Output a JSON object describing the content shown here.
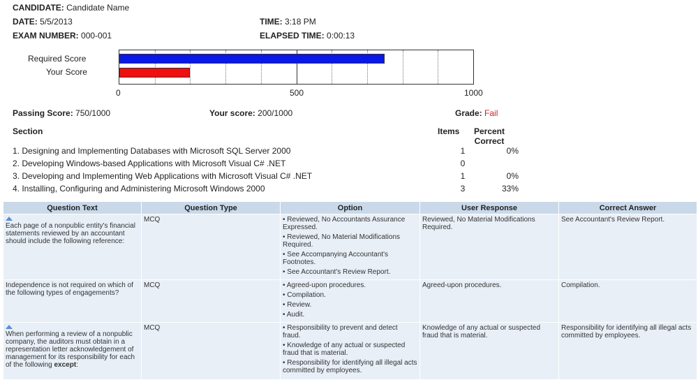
{
  "header": {
    "candidate_label": "CANDIDATE:",
    "candidate_value": "Candidate Name",
    "date_label": "DATE:",
    "date_value": "5/5/2013",
    "exam_label": "EXAM NUMBER:",
    "exam_value": "000-001",
    "time_label": "TIME:",
    "time_value": "3:18 PM",
    "elapsed_label": "ELAPSED TIME:",
    "elapsed_value": "0:00:13"
  },
  "score_chart": {
    "labels": [
      "Required Score",
      "Your Score"
    ],
    "required": 750,
    "yours": 200,
    "max": 1000,
    "ticks": [
      "0",
      "500",
      "1000"
    ],
    "colors": {
      "required": "#0a18e8",
      "yours": "#f01010"
    }
  },
  "summary": {
    "passing_label": "Passing Score:",
    "passing_value": "750/1000",
    "your_label": "Your score:",
    "your_value": "200/1000",
    "grade_label": "Grade:",
    "grade_value": "Fail",
    "grade_color": "#cc2222"
  },
  "sections": {
    "header_section": "Section",
    "header_items": "Items",
    "header_percent_1": "Percent",
    "header_percent_2": "Correct",
    "rows": [
      {
        "name": "1. Designing and Implementing Databases with Microsoft SQL Server 2000",
        "items": "1",
        "percent": "0%"
      },
      {
        "name": "2. Developing Windows-based Applications with Microsoft Visual C# .NET",
        "items": "0",
        "percent": ""
      },
      {
        "name": "3. Developing and Implementing Web Applications with Microsoft Visual C# .NET",
        "items": "1",
        "percent": "0%"
      },
      {
        "name": "4. Installing, Configuring and Administering Microsoft Windows 2000",
        "items": "3",
        "percent": "33%"
      }
    ]
  },
  "questions": {
    "columns": [
      "Question Text",
      "Question Type",
      "Option",
      "User Response",
      "Correct Answer"
    ],
    "rows": [
      {
        "text": "Each page of a nonpublic entity's financial statements reviewed by an accountant should include the following reference:",
        "bold": "",
        "type": "MCQ",
        "options": [
          "Reviewed, No Accountants Assurance Expressed.",
          "Reviewed, No Material Modifications Required.",
          "See Accompanying Accountant's Footnotes.",
          "See Accountant's Review Report."
        ],
        "response": "Reviewed, No Material Modifications Required.",
        "answer": "See Accountant's Review Report."
      },
      {
        "text": "Independence is not required on which of the following types of engagements?",
        "bold": "",
        "type": "MCQ",
        "options": [
          "Agreed-upon procedures.",
          "Compilation.",
          "Review.",
          "Audit."
        ],
        "response": "Agreed-upon procedures.",
        "answer": "Compilation."
      },
      {
        "text": "When performing a review of a nonpublic company, the auditors must obtain in a representation letter acknowledgement of management for its responsibility for each of the following",
        "bold": "except",
        "type": "MCQ",
        "options": [
          "Responsibility to prevent and detect fraud.",
          "Knowledge of any actual or suspected fraud that is material.",
          "Responsibility for identifying all illegal acts committed by employees."
        ],
        "response": "Knowledge of any actual or suspected fraud that is material.",
        "answer": "Responsibility for identifying all illegal acts committed by employees."
      }
    ]
  }
}
